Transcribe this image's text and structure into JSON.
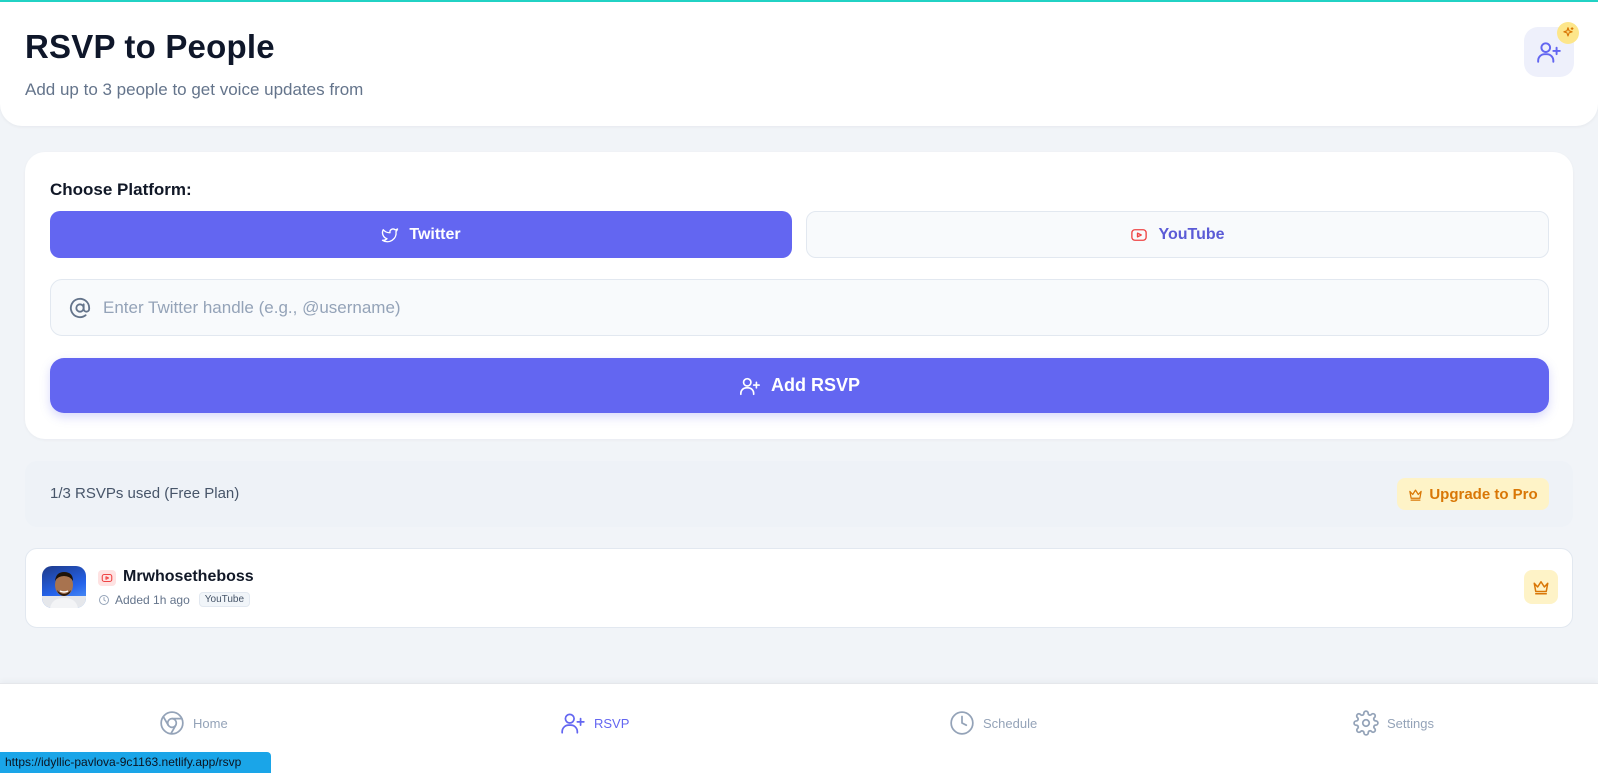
{
  "header": {
    "title": "RSVP to People",
    "subtitle": "Add up to 3 people to get voice updates from",
    "action_icon": "user-plus-icon",
    "badge_icon": "sparkle-icon"
  },
  "platform_picker": {
    "label": "Choose Platform:",
    "options": [
      {
        "label": "Twitter",
        "icon": "twitter-icon",
        "selected": true
      },
      {
        "label": "YouTube",
        "icon": "youtube-icon",
        "selected": false
      }
    ]
  },
  "handle_input": {
    "value": "",
    "placeholder": "Enter Twitter handle (e.g., @username)",
    "icon": "at-icon"
  },
  "add_button": {
    "label": "Add RSVP",
    "icon": "user-plus-icon"
  },
  "usage": {
    "text": "1/3 RSVPs used (Free Plan)",
    "upgrade_label": "Upgrade to Pro",
    "upgrade_icon": "crown-icon"
  },
  "rsvps": [
    {
      "name": "Mrwhosetheboss",
      "platform_icon": "youtube-icon",
      "added": "Added 1h ago",
      "platform": "YouTube",
      "action_icon": "crown-icon"
    }
  ],
  "nav": {
    "items": [
      {
        "label": "Home",
        "icon": "chrome-icon",
        "active": false
      },
      {
        "label": "RSVP",
        "icon": "user-plus-icon",
        "active": true
      },
      {
        "label": "Schedule",
        "icon": "clock-icon",
        "active": false
      },
      {
        "label": "Settings",
        "icon": "gear-icon",
        "active": false
      }
    ]
  },
  "status_bar": {
    "url": "https://idyllic-pavlova-9c1163.netlify.app/rsvp"
  },
  "colors": {
    "primary": "#6366f1",
    "accent_line": "#22d3c5",
    "pro": "#d97706",
    "pro_bg": "#fef3c7",
    "youtube_red": "#ef4444"
  }
}
